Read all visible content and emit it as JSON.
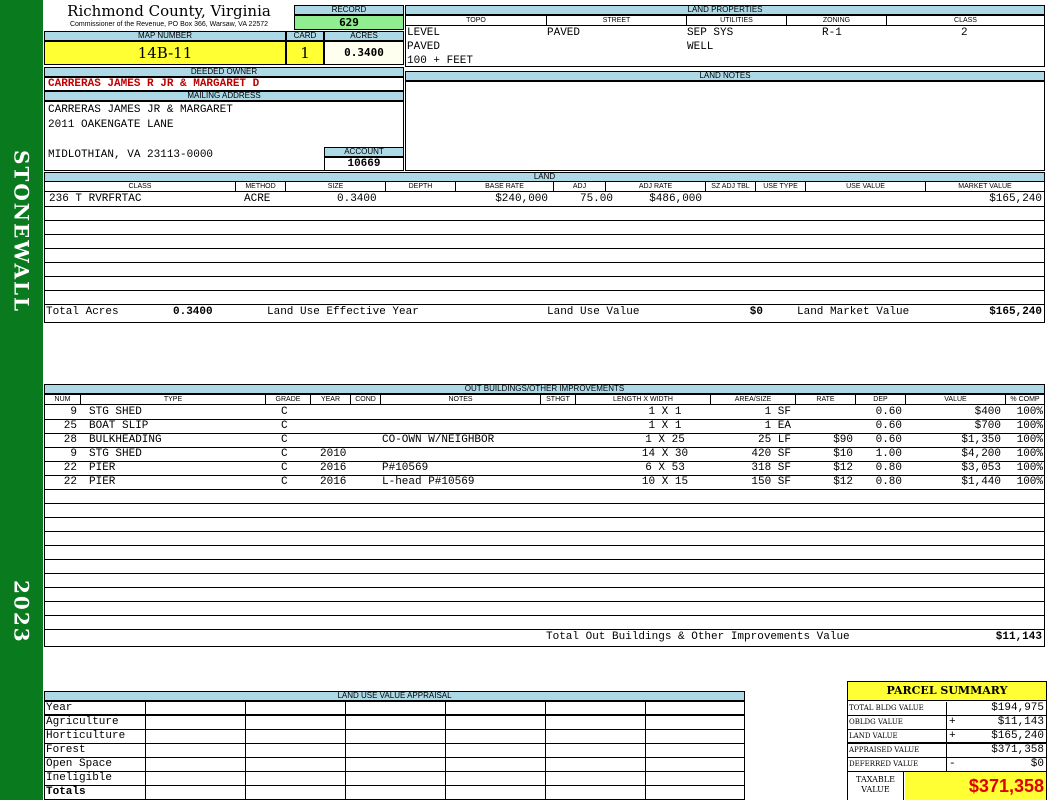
{
  "sidebar": {
    "name": "STONEWALL",
    "year": "2023"
  },
  "county": {
    "title": "Richmond County, Virginia",
    "subtitle": "Commissioner of the Revenue, PO Box 366, Warsaw, VA 22572"
  },
  "record": {
    "label": "RECORD",
    "value": "629"
  },
  "map_number": {
    "label": "MAP NUMBER",
    "value": "14B-11"
  },
  "card": {
    "label": "CARD",
    "value": "1"
  },
  "acres": {
    "label": "ACRES",
    "value": "0.3400"
  },
  "deeded_owner": {
    "label": "DEEDED OWNER",
    "value": "CARRERAS JAMES R JR & MARGARET D"
  },
  "mailing_address": {
    "label": "MAILING ADDRESS",
    "line1": "CARRERAS JAMES JR & MARGARET",
    "line2": "2011 OAKENGATE LANE",
    "line3": "MIDLOTHIAN, VA 23113-0000"
  },
  "account": {
    "label": "ACCOUNT",
    "value": "10669"
  },
  "land_properties": {
    "label": "LAND PROPERTIES",
    "headers": [
      "TOPO",
      "STREET",
      "UTILITIES",
      "ZONING",
      "CLASS"
    ],
    "topo": [
      "LEVEL",
      "PAVED",
      "100 + FEET"
    ],
    "street": "PAVED",
    "utilities": [
      "SEP SYS",
      "WELL"
    ],
    "zoning": "R-1",
    "class": "2"
  },
  "land_notes": {
    "label": "LAND NOTES"
  },
  "land": {
    "label": "LAND",
    "headers": [
      "CLASS",
      "METHOD",
      "SIZE",
      "DEPTH",
      "BASE RATE",
      "ADJ",
      "ADJ RATE",
      "SZ ADJ TBL",
      "USE TYPE",
      "USE VALUE",
      "MARKET VALUE"
    ],
    "row": {
      "class": "236 T RVRFRTAC",
      "method": "ACRE",
      "size": "0.3400",
      "base_rate": "$240,000",
      "adj": "75.00",
      "adj_rate": "$486,000",
      "market_value": "$165,240"
    },
    "totals": {
      "total_acres_label": "Total Acres",
      "total_acres": "0.3400",
      "effective_year_label": "Land Use Effective Year",
      "use_value_label": "Land Use Value",
      "use_value": "$0",
      "market_label": "Land Market Value",
      "market_value": "$165,240"
    }
  },
  "outbuildings": {
    "label": "OUT BUILDINGS/OTHER IMPROVEMENTS",
    "headers": [
      "NUM",
      "TYPE",
      "GRADE",
      "YEAR",
      "COND",
      "NOTES",
      "STHGT",
      "LENGTH X WIDTH",
      "AREA/SIZE",
      "RATE",
      "DEP",
      "VALUE",
      "% COMP"
    ],
    "rows": [
      {
        "num": "9",
        "type": "STG SHED",
        "grade": "C",
        "year": "",
        "notes": "",
        "lw": "1 X 1",
        "area": "1 SF",
        "rate": "",
        "dep": "0.60",
        "value": "$400",
        "comp": "100%"
      },
      {
        "num": "25",
        "type": "BOAT SLIP",
        "grade": "C",
        "year": "",
        "notes": "",
        "lw": "1 X 1",
        "area": "1 EA",
        "rate": "",
        "dep": "0.60",
        "value": "$700",
        "comp": "100%"
      },
      {
        "num": "28",
        "type": "BULKHEADING",
        "grade": "C",
        "year": "",
        "notes": "CO-OWN W/NEIGHBOR",
        "lw": "1 X 25",
        "area": "25 LF",
        "rate": "$90",
        "dep": "0.60",
        "value": "$1,350",
        "comp": "100%"
      },
      {
        "num": "9",
        "type": "STG SHED",
        "grade": "C",
        "year": "2010",
        "notes": "",
        "lw": "14 X 30",
        "area": "420 SF",
        "rate": "$10",
        "dep": "1.00",
        "value": "$4,200",
        "comp": "100%"
      },
      {
        "num": "22",
        "type": "PIER",
        "grade": "C",
        "year": "2016",
        "notes": "P#10569",
        "lw": "6 X 53",
        "area": "318 SF",
        "rate": "$12",
        "dep": "0.80",
        "value": "$3,053",
        "comp": "100%"
      },
      {
        "num": "22",
        "type": "PIER",
        "grade": "C",
        "year": "2016",
        "notes": "L-head P#10569",
        "lw": "10 X 15",
        "area": "150 SF",
        "rate": "$12",
        "dep": "0.80",
        "value": "$1,440",
        "comp": "100%"
      }
    ],
    "total_label": "Total Out Buildings & Other Improvements Value",
    "total_value": "$11,143"
  },
  "land_use_appraisal": {
    "label": "LAND USE VALUE APPRAISAL",
    "rows": [
      "Year",
      "Agriculture",
      "Horticulture",
      "Forest",
      "Open Space",
      "Ineligible",
      "Totals"
    ]
  },
  "parcel_summary": {
    "title": "PARCEL SUMMARY",
    "rows": [
      {
        "label": "TOTAL BLDG VALUE",
        "op": "",
        "value": "$194,975"
      },
      {
        "label": "OBLDG VALUE",
        "op": "+",
        "value": "$11,143"
      },
      {
        "label": "LAND VALUE",
        "op": "+",
        "value": "$165,240"
      },
      {
        "label": "APPRAISED VALUE",
        "op": "",
        "value": "$371,358"
      },
      {
        "label": "DEFERRED VALUE",
        "op": "-",
        "value": "$0"
      }
    ],
    "taxable_label_1": "TAXABLE",
    "taxable_label_2": "VALUE",
    "taxable_value": "$371,358"
  }
}
